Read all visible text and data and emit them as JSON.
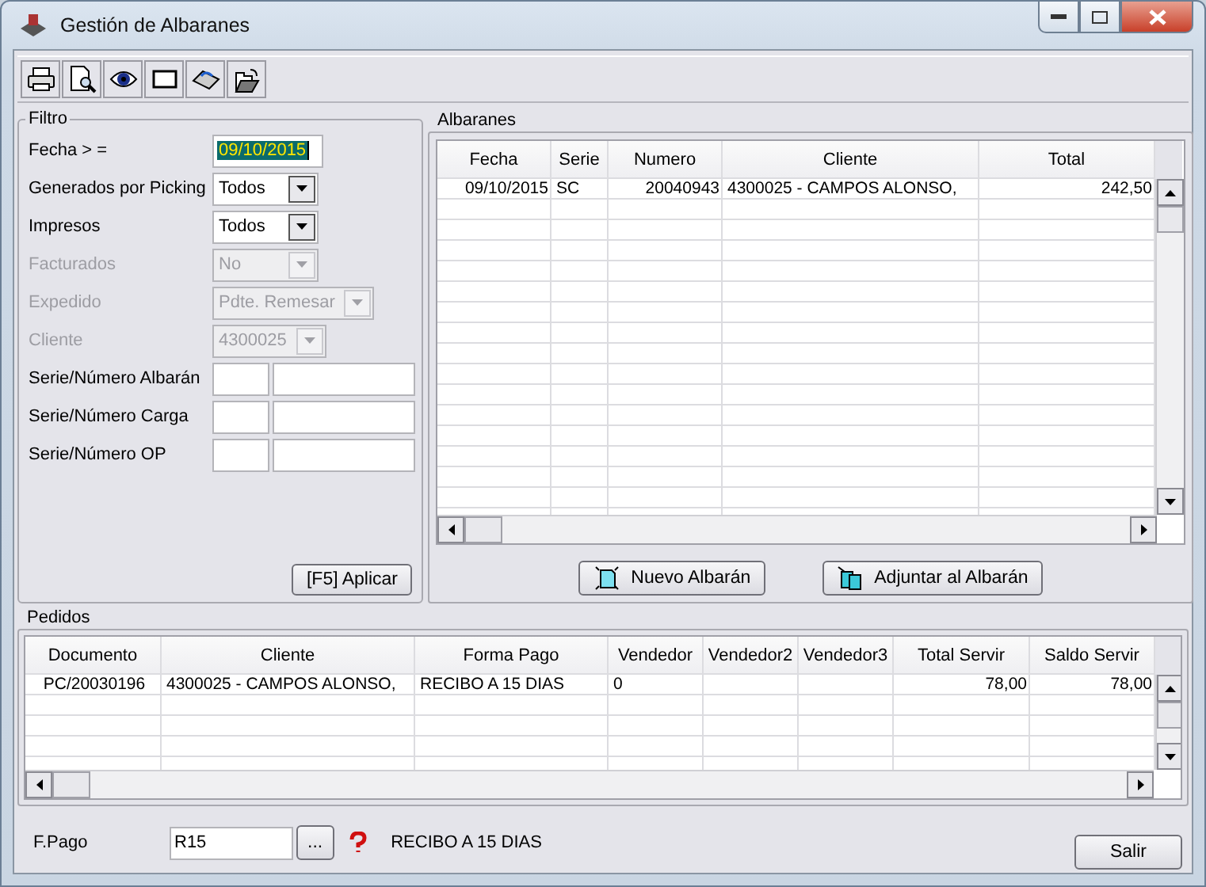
{
  "window": {
    "title": "Gestión de Albaranes"
  },
  "filter": {
    "title": "Filtro",
    "fields": [
      {
        "kind": "date",
        "label": "Fecha > =",
        "value": "09/10/2015",
        "highlighted": true,
        "disabled": false
      },
      {
        "kind": "select",
        "label": "Generados por Picking",
        "value": "Todos",
        "disabled": false
      },
      {
        "kind": "select",
        "label": "Impresos",
        "value": "Todos",
        "disabled": false
      },
      {
        "kind": "select",
        "label": "Facturados",
        "value": "No",
        "disabled": true
      },
      {
        "kind": "select",
        "label": "Expedido",
        "value": "Pdte. Remesar",
        "disabled": true
      },
      {
        "kind": "select",
        "label": "Cliente",
        "value": "4300025",
        "disabled": true
      },
      {
        "kind": "pair",
        "label": "Serie/Número Albarán",
        "disabled": false
      },
      {
        "kind": "pair",
        "label": "Serie/Número Carga",
        "disabled": false
      },
      {
        "kind": "pair",
        "label": "Serie/Número OP",
        "disabled": false
      }
    ],
    "apply": "[F5] Aplicar"
  },
  "albaranes": {
    "title": "Albaranes",
    "columns": [
      "Fecha",
      "Serie",
      "Numero",
      "Cliente",
      "Total"
    ],
    "rows": [
      [
        "09/10/2015",
        "SC",
        "20040943",
        "4300025 - CAMPOS ALONSO,",
        "242,50"
      ]
    ],
    "buttons": [
      "Nuevo Albarán",
      "Adjuntar al Albarán"
    ]
  },
  "pedidos": {
    "title": "Pedidos",
    "columns": [
      "Documento",
      "Cliente",
      "Forma Pago",
      "Vendedor",
      "Vendedor2",
      "Vendedor3",
      "Total Servir",
      "Saldo Servir"
    ],
    "rows": [
      [
        "PC/20030196",
        "4300025 - CAMPOS ALONSO,",
        "RECIBO A 15 DIAS",
        "0",
        "",
        "",
        "78,00",
        "78,00"
      ]
    ]
  },
  "footer": {
    "label": "F.Pago",
    "value": "R15",
    "browse": "...",
    "description": "RECIBO A 15 DIAS",
    "exit": "Salir"
  }
}
